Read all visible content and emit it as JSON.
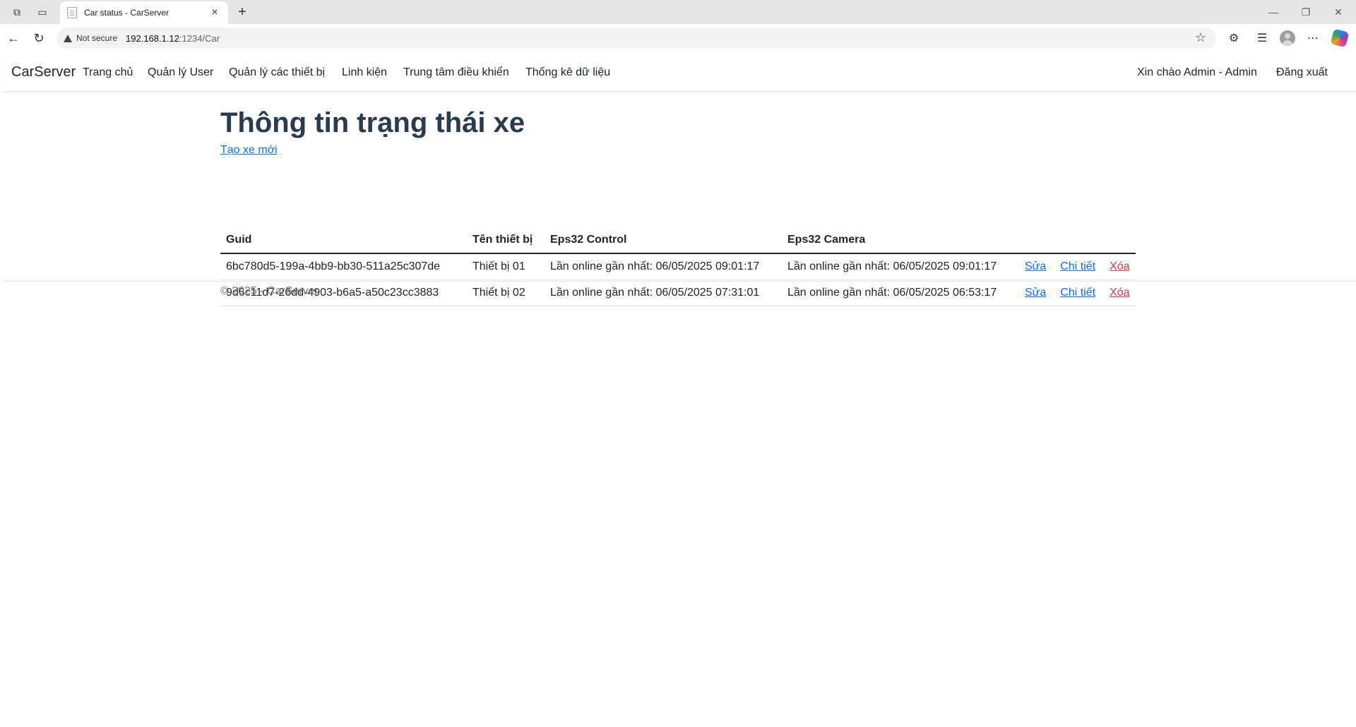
{
  "browser": {
    "tab_title": "Car status - CarServer",
    "security_label": "Not secure",
    "url_host": "192.168.1.12",
    "url_rest": ":1234/Car"
  },
  "navbar": {
    "brand": "CarServer",
    "links": [
      "Trang chủ",
      "Quản lý User",
      "Quản lý các thiết bị",
      "Linh kiện",
      "Trung tâm điều khiển",
      "Thống kê dữ liệu"
    ],
    "greeting": "Xin chào Admin - Admin",
    "logout": "Đăng xuất"
  },
  "main": {
    "title": "Thông tin trạng thái xe",
    "create_link": "Tạo xe mới",
    "table": {
      "headers": [
        "Guid",
        "Tên thiết bị",
        "Eps32 Control",
        "Eps32 Camera",
        ""
      ],
      "rows": [
        {
          "guid": "6bc780d5-199a-4bb9-bb30-511a25c307de",
          "name": "Thiết bị 01",
          "control": "Lần online gần nhất: 06/05/2025 09:01:17",
          "camera": "Lần online gần nhất: 06/05/2025 09:01:17",
          "edit": "Sửa",
          "detail": "Chi tiết",
          "delete": "Xóa"
        },
        {
          "guid": "9d6c11d7-26dd-4903-b6a5-a50c23cc3883",
          "name": "Thiết bị 02",
          "control": "Lần online gần nhất: 06/05/2025 07:31:01",
          "camera": "Lần online gần nhất: 06/05/2025 06:53:17",
          "edit": "Sửa",
          "detail": "Chi tiết",
          "delete": "Xóa"
        }
      ]
    }
  },
  "footer": {
    "text": "© 2025 - CarServer"
  },
  "colors": {
    "link": "#0d6efd",
    "danger": "#dc3545",
    "title": "#2a3a4f"
  }
}
